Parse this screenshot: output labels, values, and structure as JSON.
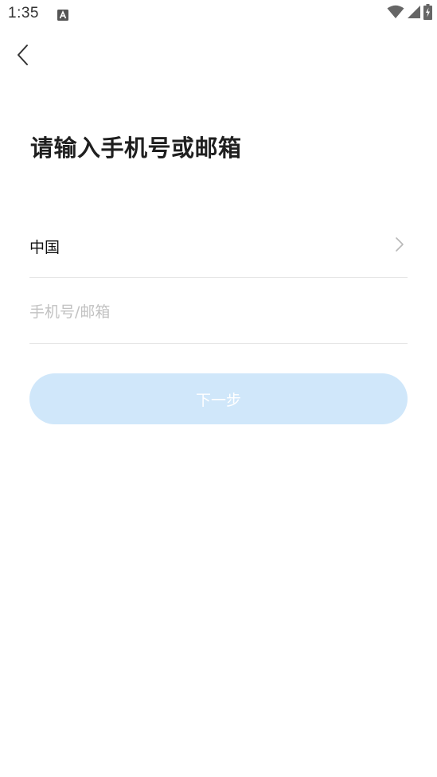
{
  "status_bar": {
    "time": "1:35",
    "notification_icon": "a-app-icon",
    "wifi_icon": "wifi-icon",
    "signal_icon": "cell-signal-icon",
    "battery_icon": "battery-charging-icon"
  },
  "nav": {
    "back_icon": "chevron-left-icon"
  },
  "page": {
    "title": "请输入手机号或邮箱"
  },
  "region": {
    "label": "中国",
    "icon": "chevron-right-icon"
  },
  "account_input": {
    "value": "",
    "placeholder": "手机号/邮箱"
  },
  "next_button": {
    "label": "下一步",
    "state": "disabled"
  },
  "colors": {
    "background": "#ffffff",
    "button_disabled_bg": "#d0e7fa",
    "button_text": "#ffffff",
    "divider": "#e6e6e6",
    "placeholder": "#c2c2c2",
    "title": "#1f1f1f"
  }
}
